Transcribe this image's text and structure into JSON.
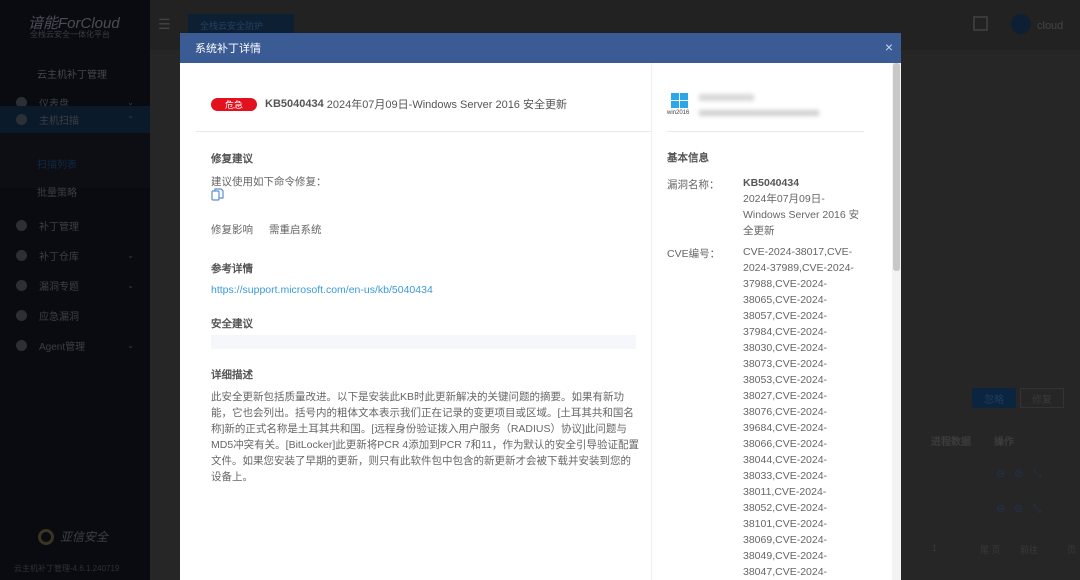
{
  "app": {
    "logo": "谙能ForCloud",
    "logo_sub": "全栈云安全一体化平台",
    "section_title": "云主机补丁管理",
    "footer_brand": "亚信安全",
    "version": "云主机补丁管理-4.6.1.240719"
  },
  "sidebar": {
    "items": [
      {
        "label": "仪表盘"
      },
      {
        "label": "主机扫描"
      },
      {
        "label": "补丁管理"
      },
      {
        "label": "补丁仓库"
      },
      {
        "label": "漏洞专题"
      },
      {
        "label": "应急漏洞"
      },
      {
        "label": "Agent管理"
      }
    ],
    "sub_items": [
      {
        "label": "扫描列表"
      },
      {
        "label": "批量策略"
      }
    ]
  },
  "topbar": {
    "scope": "全栈云安全防护",
    "user": "cloud"
  },
  "background": {
    "ignore": "忽略",
    "fix": "修复",
    "col_process": "进程数据",
    "col_ops": "操作",
    "ops_icons": "⊖ ⊘ ⤡",
    "page_num": "1",
    "last_page": "尾 页",
    "goto": "前往",
    "page_unit": "页"
  },
  "modal": {
    "title": "系统补丁详情",
    "severity": "危急",
    "kb": "KB5040434",
    "patch_title": "2024年07月09日-Windows Server 2016 安全更新",
    "fix_heading": "修复建议",
    "fix_text": "建议使用如下命令修复：",
    "impact_label": "修复影响",
    "impact_value": "需重启系统",
    "ref_heading": "参考详情",
    "ref_link": "https://support.microsoft.com/en-us/kb/5040434",
    "security_heading": "安全建议",
    "desc_heading": "详细描述",
    "description": "此安全更新包括质量改进。以下是安装此KB时此更新解决的关键问题的摘要。如果有新功能，它也会列出。括号内的粗体文本表示我们正在记录的变更项目或区域。[土耳其共和国名称]新的正式名称是土耳其共和国。[远程身份验证拨入用户服务（RADIUS）协议]此问题与MD5冲突有关。[BitLocker]此更新将PCR 4添加到PCR 7和11，作为默认的安全引导验证配置文件。如果您安装了早期的更新，则只有此软件包中包含的新更新才会被下载并安装到您的设备上。",
    "os_label": "win2016",
    "basic_heading": "基本信息",
    "vuln_name_label": "漏洞名称：",
    "vuln_name_kb": "KB5040434",
    "vuln_name_rest": "2024年07月09日-Windows Server 2016 安全更新",
    "cve_label": "CVE编号：",
    "cve_list": "CVE-2024-38017,CVE-2024-37989,CVE-2024-37988,CVE-2024-38065,CVE-2024-38057,CVE-2024-37984,CVE-2024-38030,CVE-2024-38073,CVE-2024-38053,CVE-2024-38027,CVE-2024-38076,CVE-2024-39684,CVE-2024-38066,CVE-2024-38044,CVE-2024-38033,CVE-2024-38011,CVE-2024-38052,CVE-2024-38101,CVE-2024-38069,CVE-2024-38049,CVE-2024-38047,CVE-2024-"
  },
  "colors": {
    "header": "#3b5b95",
    "severity": "#e3101e",
    "link": "#3a9ad9"
  }
}
